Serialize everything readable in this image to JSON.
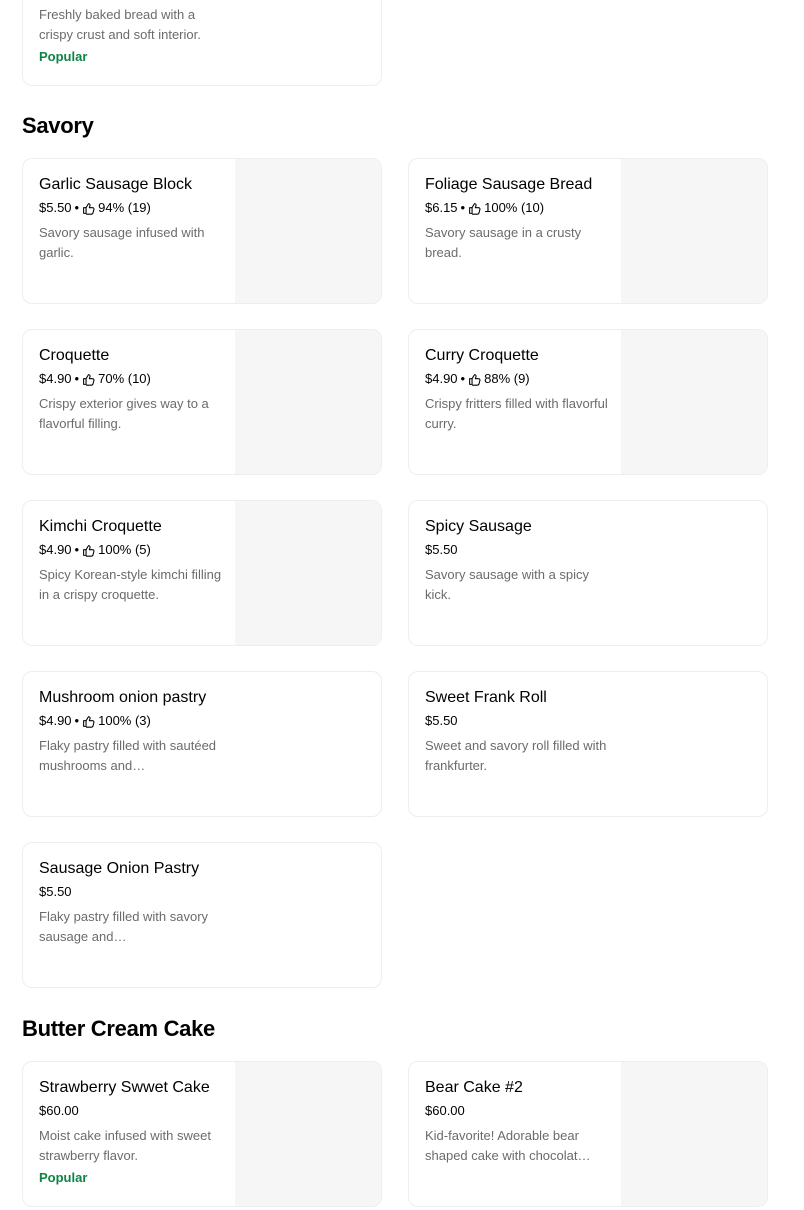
{
  "top_card": {
    "desc": "Freshly baked bread with a crispy crust and soft interior.",
    "badge": "Popular"
  },
  "sections": {
    "savory": {
      "title": "Savory",
      "items": [
        {
          "name": "Garlic Sausage Block",
          "price": "$5.50",
          "rating": "94% (19)",
          "desc": "Savory sausage infused with garlic."
        },
        {
          "name": "Foliage Sausage Bread",
          "price": "$6.15",
          "rating": "100% (10)",
          "desc": "Savory sausage in a crusty bread."
        },
        {
          "name": "Croquette",
          "price": "$4.90",
          "rating": "70% (10)",
          "desc": "Crispy exterior gives way to a flavorful filling."
        },
        {
          "name": "Curry Croquette",
          "price": "$4.90",
          "rating": "88% (9)",
          "desc": "Crispy fritters filled with flavorful curry."
        },
        {
          "name": "Kimchi Croquette",
          "price": "$4.90",
          "rating": "100% (5)",
          "desc": "Spicy Korean-style kimchi filling in a crispy croquette."
        },
        {
          "name": "Spicy Sausage",
          "price": "$5.50",
          "desc": "Savory sausage with a spicy kick."
        },
        {
          "name": "Mushroom onion pastry",
          "price": "$4.90",
          "rating": "100% (3)",
          "desc": "Flaky pastry filled with sautéed mushrooms and…"
        },
        {
          "name": "Sweet Frank Roll",
          "price": "$5.50",
          "desc": "Sweet and savory roll filled with frankfurter."
        },
        {
          "name": "Sausage Onion Pastry",
          "price": "$5.50",
          "desc": "Flaky pastry filled with savory sausage and…"
        }
      ]
    },
    "butter_cream_cake": {
      "title": "Butter Cream Cake",
      "items": [
        {
          "name": "Strawberry Swwet Cake",
          "price": "$60.00",
          "desc": "Moist cake infused with sweet strawberry flavor.",
          "badge": "Popular"
        },
        {
          "name": "Bear Cake #2",
          "price": "$60.00",
          "desc": "Kid-favorite! Adorable bear shaped cake with chocolat…"
        }
      ]
    }
  },
  "separator": "•",
  "icons": {
    "rating": "thumbs-up-icon"
  },
  "colors": {
    "popular": "#0e8345",
    "muted": "#6b6b6b",
    "placeholder": "#f6f6f6",
    "border": "#eeeeee"
  }
}
